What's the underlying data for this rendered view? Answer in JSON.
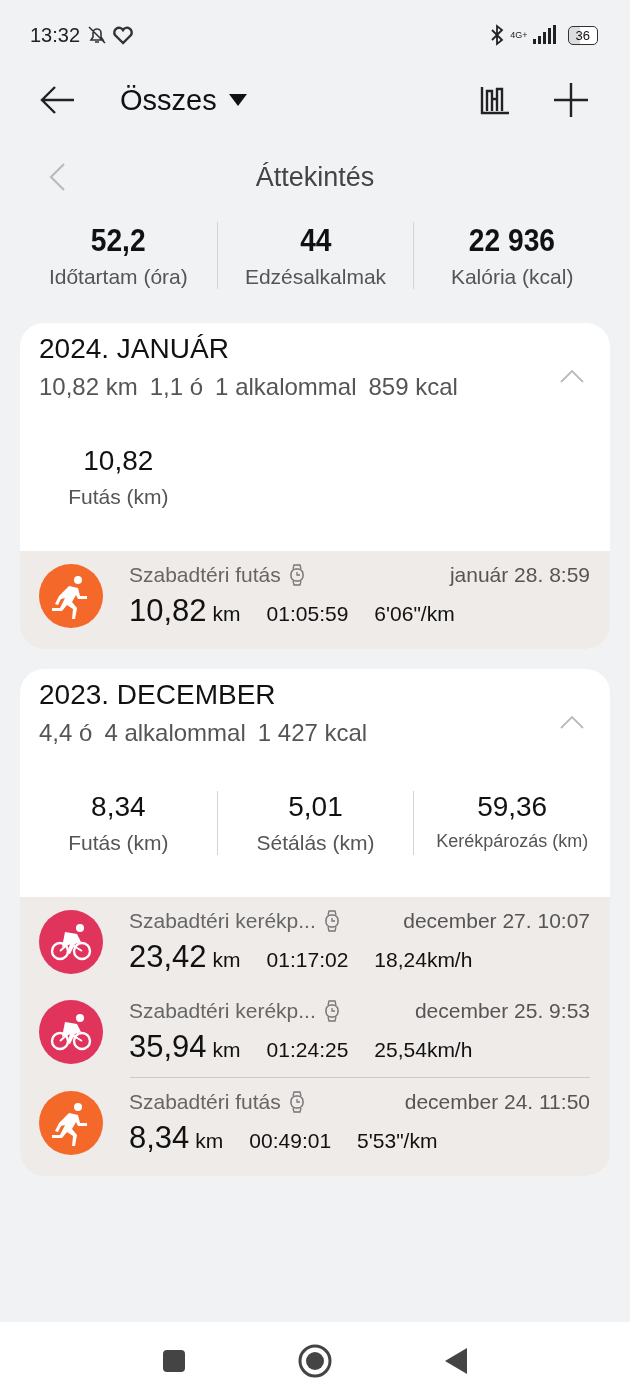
{
  "status_bar": {
    "time": "13:32",
    "network": "4G+",
    "battery": "36"
  },
  "header": {
    "title": "Összes"
  },
  "overview": {
    "title": "Áttekintés",
    "stats": [
      {
        "value": "52,2",
        "label": "Időtartam (óra)"
      },
      {
        "value": "44",
        "label": "Edzésalkalmak"
      },
      {
        "value": "22 936",
        "label": "Kalória (kcal)"
      }
    ]
  },
  "months": [
    {
      "title": "2024. JANUÁR",
      "summary": [
        "10,82 km",
        "1,1 ó",
        "1 alkalommal",
        "859 kcal"
      ],
      "expanded": true,
      "stats": [
        {
          "value": "10,82",
          "label": "Futás (km)"
        }
      ],
      "activities": [
        {
          "kind": "run",
          "name": "Szabadtéri futás",
          "date": "január 28. 8:59",
          "distance": "10,82",
          "unit": "km",
          "duration": "01:05:59",
          "pace": "6'06\"/km"
        }
      ]
    },
    {
      "title": "2023. DECEMBER",
      "summary": [
        "4,4 ó",
        "4 alkalommal",
        "1 427 kcal"
      ],
      "expanded": true,
      "stats": [
        {
          "value": "8,34",
          "label": "Futás (km)"
        },
        {
          "value": "5,01",
          "label": "Sétálás (km)"
        },
        {
          "value": "59,36",
          "label": "Kerékpározás (km)"
        }
      ],
      "activities": [
        {
          "kind": "bike",
          "name": "Szabadtéri kerékp...",
          "date": "december 27. 10:07",
          "distance": "23,42",
          "unit": "km",
          "duration": "01:17:02",
          "pace": "18,24km/h"
        },
        {
          "kind": "bike",
          "name": "Szabadtéri kerékp...",
          "date": "december 25. 9:53",
          "distance": "35,94",
          "unit": "km",
          "duration": "01:24:25",
          "pace": "25,54km/h"
        },
        {
          "kind": "run",
          "name": "Szabadtéri futás",
          "date": "december 24. 11:50",
          "distance": "8,34",
          "unit": "km",
          "duration": "00:49:01",
          "pace": "5'53\"/km"
        }
      ]
    }
  ]
}
